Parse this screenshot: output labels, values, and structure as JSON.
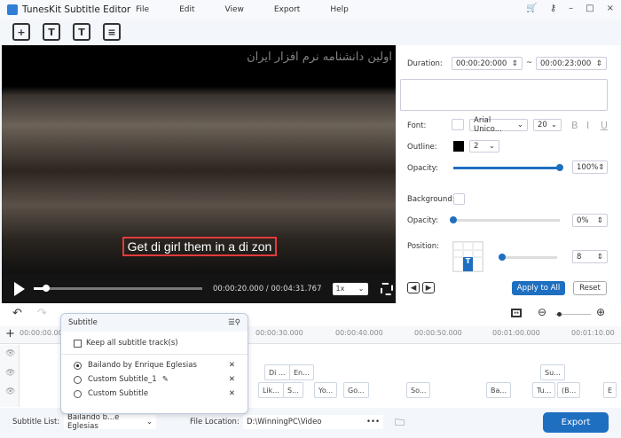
{
  "app": {
    "title": "TunesKit Subtitle Editor",
    "menu": [
      "File",
      "Edit",
      "View",
      "Export",
      "Help"
    ]
  },
  "window_controls": {
    "cart": "cart-icon",
    "key": "key-icon",
    "minimize": "–",
    "maximize": "□",
    "close": "×"
  },
  "toolbar": {
    "icons": [
      "add-video-icon",
      "add-subtitle-icon",
      "add-text-icon",
      "edit-subtitle-icon"
    ]
  },
  "video": {
    "watermark": "اولین دانشنامه نرم افزار ایران",
    "subtitle": "Get di girl them in a di zon",
    "current_time": "00:00:20.000",
    "total_time": "00:04:31.767",
    "time_sep": " / ",
    "speed": "1x",
    "progress": 0.074
  },
  "panel": {
    "duration_label": "Duration:",
    "start": "00:00:20:000",
    "tilde": "~",
    "end": "00:00:23:000",
    "text": "",
    "font_label": "Font:",
    "font": "Arial Unico...",
    "size": "20",
    "bold": "B",
    "italic": "I",
    "underline": "U",
    "outline_label": "Outline:",
    "outline_color": "#000000",
    "outline_width": "2",
    "opacity_label": "Opacity:",
    "opacity": "100%",
    "opacity_value": 1.0,
    "background_label": "Background:",
    "bg_opacity_label": "Opacity:",
    "bg_opacity": "0%",
    "bg_opacity_value": 0.0,
    "position_label": "Position:",
    "position_cell": "T",
    "position_value": "8",
    "apply_all": "Apply to All",
    "reset": "Reset"
  },
  "timeline": {
    "ticks": [
      "00:00:00.000",
      "00:00:30.000",
      "00:00:40.000",
      "00:00:50.000",
      "00:01:00.000",
      "00:01:10.00"
    ],
    "track2_clips": [
      "Di ...",
      "En...",
      "Su..."
    ],
    "track3_clips": [
      "Lik...",
      "S...",
      "Yo...",
      "Go...",
      "So...",
      "Ba...",
      "Tu...",
      "(B...",
      "E"
    ]
  },
  "popup": {
    "title": "Subtitle",
    "keep_all": "Keep all subtitle track(s)",
    "tracks": [
      {
        "name": "Bailando by Enrique Eglesias",
        "selected": true
      },
      {
        "name": "Custom Subtitle_1",
        "selected": false
      },
      {
        "name": "Custom Subtitle",
        "selected": false
      }
    ]
  },
  "bottom": {
    "list_label": "Subtitle List:",
    "list_value": "Bailando b...e Eglesias",
    "location_label": "File Location:",
    "location": "D:\\WinningPC\\Video",
    "more": "•••",
    "export": "Export"
  },
  "colors": {
    "accent": "#1f6fc0",
    "subtitle_box": "#e23b3b"
  }
}
